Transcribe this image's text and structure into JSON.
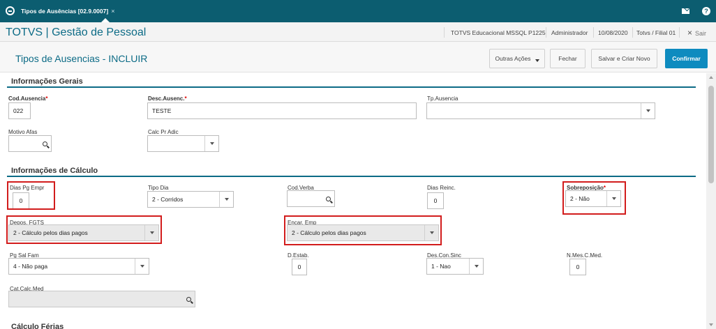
{
  "tabbar": {
    "tab_label": "Tipos de Ausências [02.9.0007]",
    "tab_close": "×",
    "icons": {
      "logo": "totvs-logo-icon",
      "mail": "mail-icon",
      "help": "help-icon"
    },
    "help_glyph": "?"
  },
  "appbar": {
    "title": "TOTVS | Gestão de Pessoal",
    "environment": "TOTVS Educacional MSSQL P1225",
    "user": "Administrador",
    "date": "10/08/2020",
    "branch": "Totvs / Filial 01",
    "exit_glyph": "×",
    "exit_label": "Sair"
  },
  "page": {
    "title": "Tipos de Ausencias - INCLUIR",
    "buttons": {
      "other_actions": "Outras Ações",
      "close": "Fechar",
      "save_new": "Salvar e Criar Novo",
      "confirm": "Confirmar"
    }
  },
  "sections": {
    "general": {
      "title": "Informações Gerais",
      "cod_ausencia": {
        "label": "Cod.Ausencia",
        "value": "022"
      },
      "desc_ausenc": {
        "label": "Desc.Ausenc.",
        "value": "TESTE"
      },
      "tp_ausencia": {
        "label": "Tp.Ausencia",
        "value": ""
      },
      "motivo_afast": {
        "label": "Motivo Afas",
        "value": ""
      },
      "calc_pr_adic": {
        "label": "Calc Pr Adic",
        "value": ""
      },
      "required_mark": "*"
    },
    "calc": {
      "title": "Informações de Cálculo",
      "dias_pg_empr": {
        "label": "Dias Pg Empr",
        "value": "0"
      },
      "tipo_dia": {
        "label": "Tipo Dia",
        "value": "2 - Corridos"
      },
      "cod_verba": {
        "label": "Cod.Verba",
        "value": ""
      },
      "dias_reinc": {
        "label": "Dias Reinc.",
        "value": "0"
      },
      "sobreposicao": {
        "label": "Sobreposição",
        "value": "2 - Não"
      },
      "depos_fgts": {
        "label": "Depos. FGTS",
        "value": "2 - Cálculo pelos dias pagos"
      },
      "encar_emp": {
        "label": "Encar. Emp",
        "value": "2 - Cálculo pelos dias pagos"
      },
      "pg_sal_fam": {
        "label": "Pg Sal Fam",
        "value": "4 - Não paga"
      },
      "d_estab": {
        "label": "D.Estab.",
        "value": "0"
      },
      "des_con_sinc": {
        "label": "Des.Con.Sinc",
        "value": "1 - Nao"
      },
      "n_mes_c_med": {
        "label": "N.Mes.C.Med.",
        "value": "0"
      },
      "cat_calc_med": {
        "label": "Cat.Calc.Med",
        "value": ""
      }
    },
    "ferias": {
      "title": "Cálculo Férias"
    }
  },
  "colors": {
    "tabbar": "#0c5d70",
    "accent": "#0c6b86",
    "primary_button": "#0e8bbf",
    "highlight": "#d21c1c"
  }
}
